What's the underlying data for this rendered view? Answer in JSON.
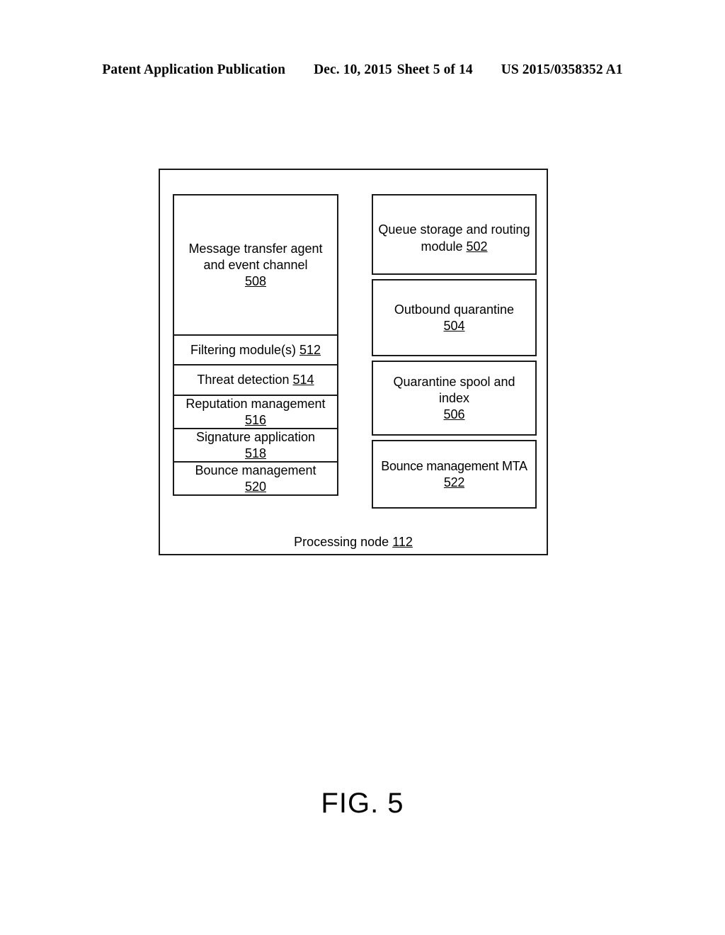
{
  "header": {
    "publication": "Patent Application Publication",
    "date": "Dec. 10, 2015",
    "sheet": "Sheet 5 of 14",
    "number": "US 2015/0358352 A1"
  },
  "figure": {
    "label": "FIG. 5",
    "container": {
      "caption_text": "Processing node",
      "caption_ref": "112"
    },
    "left_column": [
      {
        "text": "Message transfer agent\nand event channel",
        "ref": "508",
        "ref_on_own_line": true
      },
      {
        "text": "Filtering module(s)",
        "ref": "512",
        "ref_on_own_line": false
      },
      {
        "text": "Threat detection",
        "ref": "514",
        "ref_on_own_line": false
      },
      {
        "text": "Reputation management",
        "ref": "516",
        "ref_on_own_line": true
      },
      {
        "text": "Signature application",
        "ref": "518",
        "ref_on_own_line": true
      },
      {
        "text": "Bounce management",
        "ref": "520",
        "ref_on_own_line": true
      }
    ],
    "right_column": [
      {
        "text": "Queue storage and routing\nmodule",
        "ref": "502",
        "ref_on_own_line": false
      },
      {
        "text": "Outbound quarantine",
        "ref": "504",
        "ref_on_own_line": true
      },
      {
        "text": "Quarantine spool and\nindex",
        "ref": "506",
        "ref_on_own_line": true
      },
      {
        "text": "Bounce management MTA",
        "ref": "522",
        "ref_on_own_line": true
      }
    ]
  },
  "colors": {
    "ink": "#1a1a1a",
    "background": "#ffffff"
  }
}
